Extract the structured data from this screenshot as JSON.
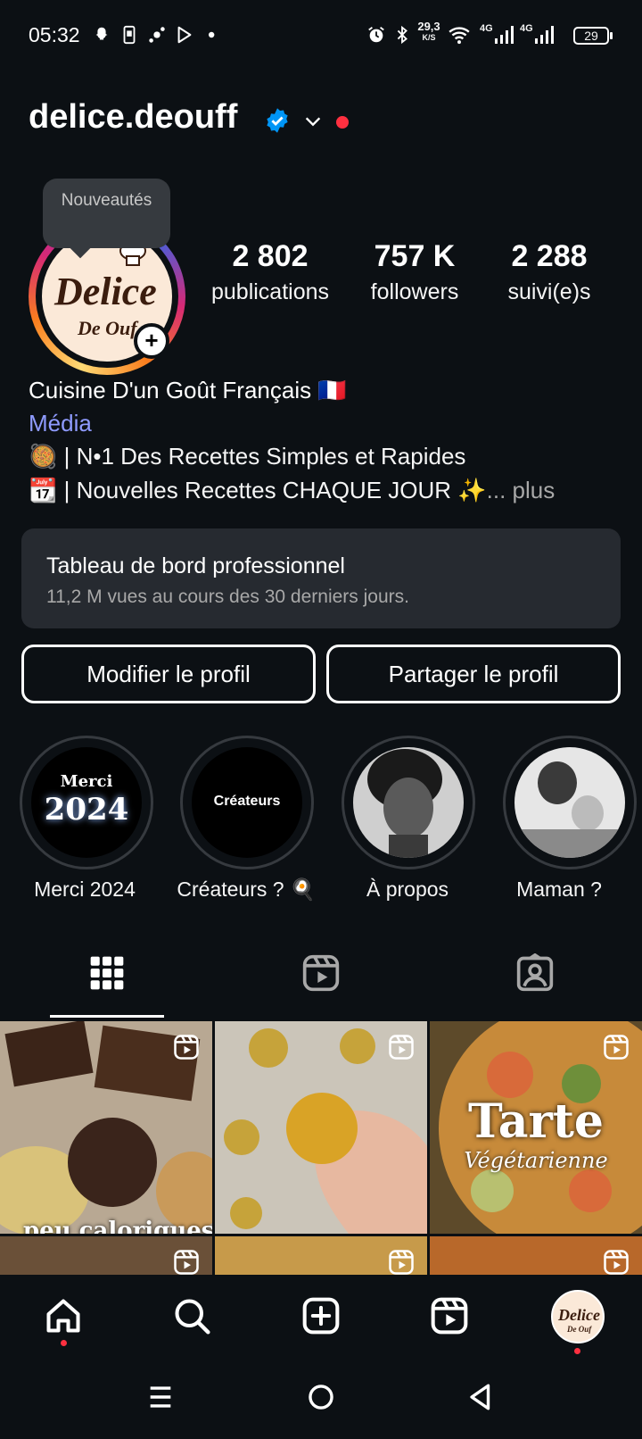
{
  "status_bar": {
    "time": "05:32",
    "net_speed_value": "29,3",
    "net_speed_unit": "K/S",
    "network_1": "4G",
    "network_2": "4G",
    "battery": "29",
    "icons": [
      "snapchat-icon",
      "screenshot-icon",
      "football-icon",
      "play-store-icon",
      "dot-icon",
      "alarm-icon",
      "bluetooth-icon",
      "wifi-icon",
      "signal-icon",
      "signal-icon"
    ]
  },
  "header": {
    "username": "delice.deouff",
    "verified": true,
    "accent_color": "#0095f6",
    "notification_color": "#ff3040"
  },
  "profile": {
    "avatar_text_1": "Delice",
    "avatar_text_2": "De Ouf",
    "tooltip": "Nouveautés",
    "stats": [
      {
        "value": "2 802",
        "label": "publications"
      },
      {
        "value": "757 K",
        "label": "followers"
      },
      {
        "value": "2 288",
        "label": "suivi(e)s"
      }
    ]
  },
  "bio": {
    "name": "Cuisine D'un Goût Français 🇫🇷",
    "category": "Média",
    "line1": "🥘 | N•1 Des Recettes Simples et Rapides",
    "line2": "📆 | Nouvelles Recettes CHAQUE JOUR ✨",
    "more": "... plus"
  },
  "dashboard": {
    "title": "Tableau de bord professionnel",
    "subtitle": "11,2 M vues au cours des 30 derniers jours."
  },
  "buttons": {
    "edit": "Modifier le profil",
    "share": "Partager le profil"
  },
  "highlights": [
    {
      "label": "Merci 2024",
      "cover_line1": "Merci",
      "cover_line2": "2024"
    },
    {
      "label": "Créateurs ? 🍳",
      "cover_line1": "Créateurs"
    },
    {
      "label": "À propos"
    },
    {
      "label": "Maman ?"
    }
  ],
  "tabs": [
    {
      "name": "grid-icon",
      "active": true
    },
    {
      "name": "reels-icon",
      "active": false
    },
    {
      "name": "tagged-icon",
      "active": false
    }
  ],
  "grid": {
    "posts": [
      {
        "type": "reel",
        "caption": "peu caloriques"
      },
      {
        "type": "reel",
        "caption": ""
      },
      {
        "type": "reel",
        "caption_title": "Tarte",
        "caption_sub": "Végétarienne"
      },
      {
        "type": "reel",
        "caption": ""
      },
      {
        "type": "reel",
        "caption": ""
      },
      {
        "type": "reel",
        "caption": ""
      }
    ]
  },
  "bottom_nav": [
    "home-icon",
    "search-icon",
    "create-icon",
    "reels-icon",
    "profile-avatar"
  ]
}
